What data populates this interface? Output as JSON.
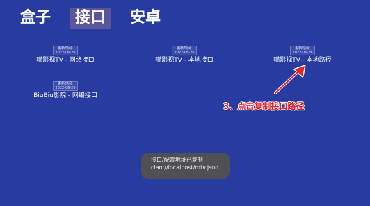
{
  "tabs": [
    {
      "label": "盒子",
      "selected": false
    },
    {
      "label": "接口",
      "selected": true
    },
    {
      "label": "安卓",
      "selected": false
    }
  ],
  "interfaces": [
    {
      "update_label": "更新时间:",
      "date": "2022-06-26",
      "name": "喵影视TV - 网络接口"
    },
    {
      "update_label": "更新时间:",
      "date": "2022-06-26",
      "name": "喵影视TV - 本地接口"
    },
    {
      "update_label": "更新时间:",
      "date": "2022-06-26",
      "name": "喵影视TV - 本地路径"
    },
    {
      "update_label": "更新时间:",
      "date": "2022-06-26",
      "name": "BiuBiu影院 - 网络接口"
    }
  ],
  "annotation": {
    "text": "3、点击复制接口路径",
    "color": "#e6202c"
  },
  "toast": {
    "line1": "接口/配置地址已复制",
    "line2": "clan://localhost/mtv.json"
  },
  "colors": {
    "background": "#283ba1",
    "selected_tab": "#5b559b",
    "toast_background": "#4f4f54"
  }
}
